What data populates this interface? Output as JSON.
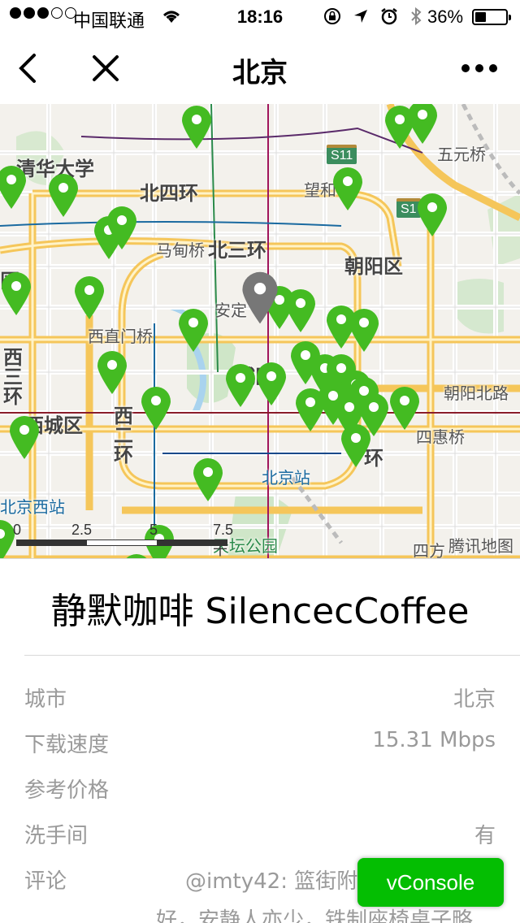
{
  "status_bar": {
    "carrier": "中国联通",
    "time": "18:16",
    "battery": "36%",
    "battery_level": 0.36
  },
  "nav": {
    "title": "北京"
  },
  "map": {
    "labels": {
      "tsinghua": "清华大学",
      "north4": "北四环",
      "wangjing": "望和",
      "wukeqiao": "五元桥",
      "madianqiao": "马甸桥",
      "north3": "北三环",
      "chaoyang": "朝阳区",
      "district_left": "区",
      "anding": "安定",
      "xizhimen": "西直门桥",
      "west3": "西\n三\n环",
      "dongcheng": "城区",
      "chaoyangbei": "朝阳北路",
      "xicheng": "西城区",
      "west2": "西\n二\n环",
      "sihuiqiao": "四惠桥",
      "east2": "环",
      "beijingzhan": "北京站",
      "beijingxizhan": "北京西站",
      "tiantan": "天坛公园",
      "siliu": "四方",
      "s11a": "S11",
      "s11b": "S1"
    },
    "scale": {
      "ticks": [
        "0",
        "2.5",
        "5",
        "7.5 千米"
      ]
    },
    "watermark": "腾讯地图",
    "pin_color": "#44bb22",
    "selected_pin_color": "#777777"
  },
  "venue": {
    "name": "静默咖啡 SilencecCoffee"
  },
  "details": {
    "city_label": "城市",
    "city_value": "北京",
    "speed_label": "下载速度",
    "speed_value": "15.31 Mbps",
    "price_label": "参考价格",
    "price_value": "",
    "restroom_label": "洗手间",
    "restroom_value": "有",
    "comment_label": "评论",
    "comment_value": "@imty42: 篮街附",
    "comment_more": "好，安静人亦少，铁制座椅桌子略"
  },
  "vconsole": {
    "label": "vConsole"
  },
  "colors": {
    "accent_green": "#04be02"
  }
}
